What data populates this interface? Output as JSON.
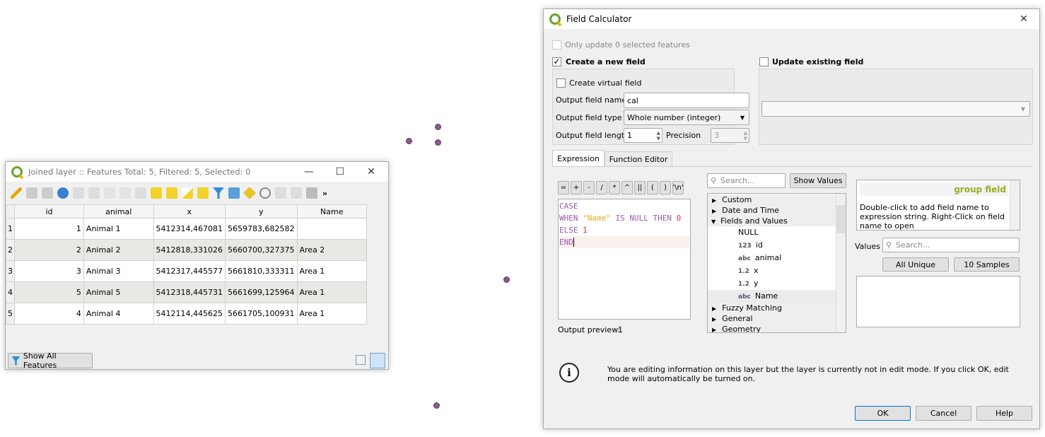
{
  "map": {
    "point_color": "#8a5b8e"
  },
  "attribute_table": {
    "title": "Joined layer :: Features Total: 5, Filtered: 5, Selected: 0",
    "columns": [
      "id",
      "animal",
      "x",
      "y",
      "Name"
    ],
    "rows": [
      {
        "n": "1",
        "id": "1",
        "animal": "Animal 1",
        "x": "5412314,467081",
        "y": "5659783,682582",
        "name": ""
      },
      {
        "n": "2",
        "id": "2",
        "animal": "Animal 2",
        "x": "5412818,331026",
        "y": "5660700,327375",
        "name": "Area 2"
      },
      {
        "n": "3",
        "id": "3",
        "animal": "Animal 3",
        "x": "5412317,445577",
        "y": "5661810,333311",
        "name": "Area 1"
      },
      {
        "n": "4",
        "id": "5",
        "animal": "Animal 5",
        "x": "5412318,445731",
        "y": "5661699,125964",
        "name": "Area 1"
      },
      {
        "n": "5",
        "id": "4",
        "animal": "Animal 4",
        "x": "5412114,445625",
        "y": "5661705,100931",
        "name": "Area 1"
      }
    ],
    "show_all_label": "Show All Features",
    "more": "»"
  },
  "calc": {
    "title": "Field Calculator",
    "only_update": "Only update 0 selected features",
    "create_new": "Create a new field",
    "create_new_checked": true,
    "update_existing": "Update existing field",
    "create_virtual": "Create virtual field",
    "out_name_label": "Output field name",
    "out_name": "cal",
    "out_type_label": "Output field type",
    "out_type": "Whole number (integer)",
    "out_len_label": "Output field length",
    "out_len": "1",
    "precision_label": "Precision",
    "precision": "3",
    "tabs": [
      "Expression",
      "Function Editor"
    ],
    "operators": [
      "=",
      "+",
      "-",
      "/",
      "*",
      "^",
      "||",
      "(",
      ")",
      "'\\n'"
    ],
    "code": {
      "l1": "CASE",
      "l2a": "WHEN ",
      "l2b": "\"Name\"",
      "l2c": " IS NULL THEN ",
      "l2d": "0",
      "l3a": "ELSE ",
      "l3b": "1",
      "l4": "END"
    },
    "preview_label": "Output preview:",
    "preview": "1",
    "search_placeholder": "Search...",
    "show_values": "Show Values",
    "tree": {
      "custom": "Custom",
      "date": "Date and Time",
      "fields": "Fields and Values",
      "null": "NULL",
      "f1t": "123",
      "f1": "id",
      "f2t": "abc",
      "f2": "animal",
      "f3t": "1.2",
      "f3": "x",
      "f4t": "1.2",
      "f4": "y",
      "f5t": "abc",
      "f5": "Name",
      "fuzzy": "Fuzzy Matching",
      "general": "General",
      "geometry": "Geometry"
    },
    "help_title": "group field",
    "help_text": "Double-click to add field name to expression string. Right-Click on field name to open",
    "values_label": "Values",
    "values_placeholder": "Search...",
    "all_unique": "All Unique",
    "samples": "10 Samples",
    "info": "You are editing information on this layer but the layer is currently not in edit mode. If you click OK, edit mode will automatically be turned on.",
    "ok": "OK",
    "cancel": "Cancel",
    "help": "Help"
  }
}
